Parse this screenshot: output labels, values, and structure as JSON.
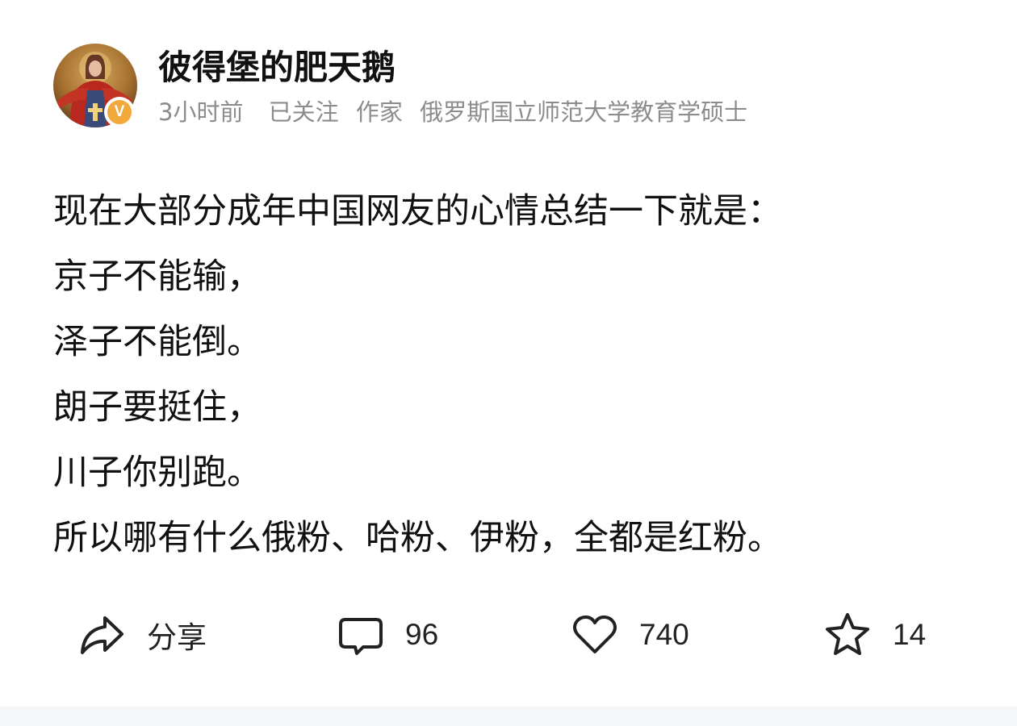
{
  "post": {
    "author": {
      "name": "彼得堡的肥天鹅",
      "verified_badge_letter": "V",
      "avatar_icon": "avatar-painting-icon"
    },
    "meta": {
      "time": "3小时前",
      "follow_status": "已关注",
      "role": "作家",
      "credential": "俄罗斯国立师范大学教育学硕士"
    },
    "content": {
      "lines": [
        "现在大部分成年中国网友的心情总结一下就是：",
        "京子不能输，",
        "泽子不能倒。",
        "朗子要挺住，",
        "川子你别跑。",
        "所以哪有什么俄粉、哈粉、伊粉，全都是红粉。"
      ]
    },
    "actions": {
      "share": {
        "label": "分享",
        "icon": "share-icon"
      },
      "comment": {
        "count": "96",
        "icon": "comment-icon"
      },
      "like": {
        "count": "740",
        "icon": "heart-icon"
      },
      "favorite": {
        "count": "14",
        "icon": "star-icon"
      }
    }
  },
  "colors": {
    "badge": "#f0a93a",
    "meta_text": "#8c8c8c",
    "body_text": "#111111"
  }
}
